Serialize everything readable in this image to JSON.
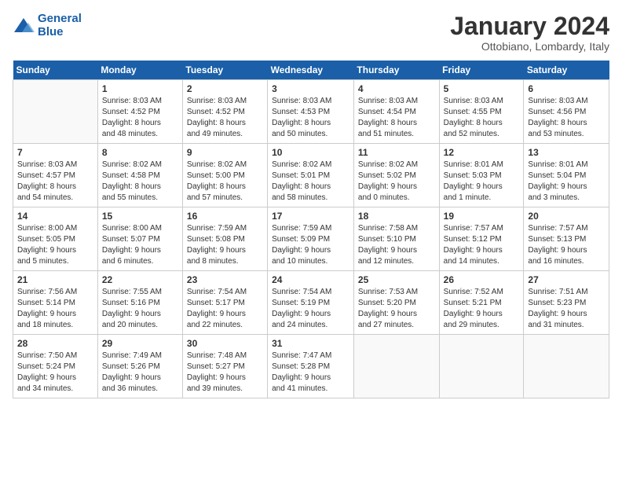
{
  "header": {
    "logo_line1": "General",
    "logo_line2": "Blue",
    "month": "January 2024",
    "location": "Ottobiano, Lombardy, Italy"
  },
  "days_of_week": [
    "Sunday",
    "Monday",
    "Tuesday",
    "Wednesday",
    "Thursday",
    "Friday",
    "Saturday"
  ],
  "weeks": [
    [
      {
        "day": "",
        "info": ""
      },
      {
        "day": "1",
        "info": "Sunrise: 8:03 AM\nSunset: 4:52 PM\nDaylight: 8 hours\nand 48 minutes."
      },
      {
        "day": "2",
        "info": "Sunrise: 8:03 AM\nSunset: 4:52 PM\nDaylight: 8 hours\nand 49 minutes."
      },
      {
        "day": "3",
        "info": "Sunrise: 8:03 AM\nSunset: 4:53 PM\nDaylight: 8 hours\nand 50 minutes."
      },
      {
        "day": "4",
        "info": "Sunrise: 8:03 AM\nSunset: 4:54 PM\nDaylight: 8 hours\nand 51 minutes."
      },
      {
        "day": "5",
        "info": "Sunrise: 8:03 AM\nSunset: 4:55 PM\nDaylight: 8 hours\nand 52 minutes."
      },
      {
        "day": "6",
        "info": "Sunrise: 8:03 AM\nSunset: 4:56 PM\nDaylight: 8 hours\nand 53 minutes."
      }
    ],
    [
      {
        "day": "7",
        "info": "Sunrise: 8:03 AM\nSunset: 4:57 PM\nDaylight: 8 hours\nand 54 minutes."
      },
      {
        "day": "8",
        "info": "Sunrise: 8:02 AM\nSunset: 4:58 PM\nDaylight: 8 hours\nand 55 minutes."
      },
      {
        "day": "9",
        "info": "Sunrise: 8:02 AM\nSunset: 5:00 PM\nDaylight: 8 hours\nand 57 minutes."
      },
      {
        "day": "10",
        "info": "Sunrise: 8:02 AM\nSunset: 5:01 PM\nDaylight: 8 hours\nand 58 minutes."
      },
      {
        "day": "11",
        "info": "Sunrise: 8:02 AM\nSunset: 5:02 PM\nDaylight: 9 hours\nand 0 minutes."
      },
      {
        "day": "12",
        "info": "Sunrise: 8:01 AM\nSunset: 5:03 PM\nDaylight: 9 hours\nand 1 minute."
      },
      {
        "day": "13",
        "info": "Sunrise: 8:01 AM\nSunset: 5:04 PM\nDaylight: 9 hours\nand 3 minutes."
      }
    ],
    [
      {
        "day": "14",
        "info": "Sunrise: 8:00 AM\nSunset: 5:05 PM\nDaylight: 9 hours\nand 5 minutes."
      },
      {
        "day": "15",
        "info": "Sunrise: 8:00 AM\nSunset: 5:07 PM\nDaylight: 9 hours\nand 6 minutes."
      },
      {
        "day": "16",
        "info": "Sunrise: 7:59 AM\nSunset: 5:08 PM\nDaylight: 9 hours\nand 8 minutes."
      },
      {
        "day": "17",
        "info": "Sunrise: 7:59 AM\nSunset: 5:09 PM\nDaylight: 9 hours\nand 10 minutes."
      },
      {
        "day": "18",
        "info": "Sunrise: 7:58 AM\nSunset: 5:10 PM\nDaylight: 9 hours\nand 12 minutes."
      },
      {
        "day": "19",
        "info": "Sunrise: 7:57 AM\nSunset: 5:12 PM\nDaylight: 9 hours\nand 14 minutes."
      },
      {
        "day": "20",
        "info": "Sunrise: 7:57 AM\nSunset: 5:13 PM\nDaylight: 9 hours\nand 16 minutes."
      }
    ],
    [
      {
        "day": "21",
        "info": "Sunrise: 7:56 AM\nSunset: 5:14 PM\nDaylight: 9 hours\nand 18 minutes."
      },
      {
        "day": "22",
        "info": "Sunrise: 7:55 AM\nSunset: 5:16 PM\nDaylight: 9 hours\nand 20 minutes."
      },
      {
        "day": "23",
        "info": "Sunrise: 7:54 AM\nSunset: 5:17 PM\nDaylight: 9 hours\nand 22 minutes."
      },
      {
        "day": "24",
        "info": "Sunrise: 7:54 AM\nSunset: 5:19 PM\nDaylight: 9 hours\nand 24 minutes."
      },
      {
        "day": "25",
        "info": "Sunrise: 7:53 AM\nSunset: 5:20 PM\nDaylight: 9 hours\nand 27 minutes."
      },
      {
        "day": "26",
        "info": "Sunrise: 7:52 AM\nSunset: 5:21 PM\nDaylight: 9 hours\nand 29 minutes."
      },
      {
        "day": "27",
        "info": "Sunrise: 7:51 AM\nSunset: 5:23 PM\nDaylight: 9 hours\nand 31 minutes."
      }
    ],
    [
      {
        "day": "28",
        "info": "Sunrise: 7:50 AM\nSunset: 5:24 PM\nDaylight: 9 hours\nand 34 minutes."
      },
      {
        "day": "29",
        "info": "Sunrise: 7:49 AM\nSunset: 5:26 PM\nDaylight: 9 hours\nand 36 minutes."
      },
      {
        "day": "30",
        "info": "Sunrise: 7:48 AM\nSunset: 5:27 PM\nDaylight: 9 hours\nand 39 minutes."
      },
      {
        "day": "31",
        "info": "Sunrise: 7:47 AM\nSunset: 5:28 PM\nDaylight: 9 hours\nand 41 minutes."
      },
      {
        "day": "",
        "info": ""
      },
      {
        "day": "",
        "info": ""
      },
      {
        "day": "",
        "info": ""
      }
    ]
  ]
}
